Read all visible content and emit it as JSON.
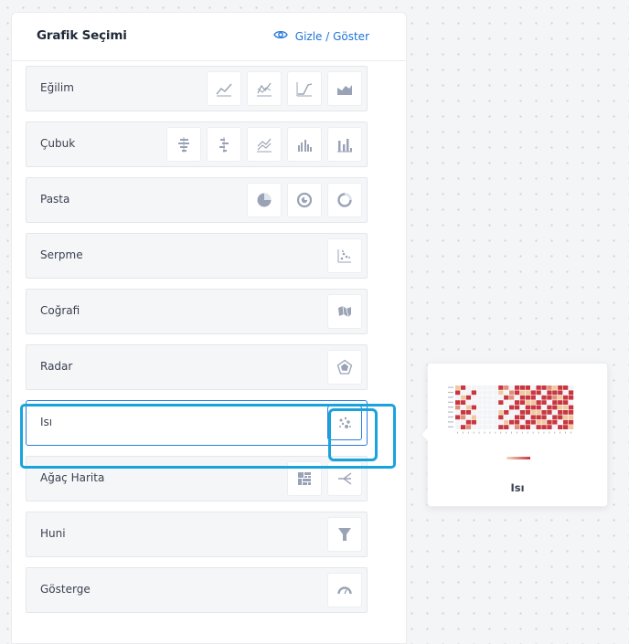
{
  "header": {
    "title": "Grafik Seçimi",
    "toggle_label": "Gizle / Göster",
    "toggle_icon": "eye-icon"
  },
  "rows": [
    {
      "label": "Eğilim",
      "icons": [
        "line-chart-icon",
        "multi-line-chart-icon",
        "step-line-chart-icon",
        "area-chart-icon"
      ]
    },
    {
      "label": "Çubuk",
      "icons": [
        "horizontal-bar-icon",
        "horizontal-stacked-bar-icon",
        "bar-line-combo-icon",
        "grouped-bar-icon",
        "column-bar-icon"
      ]
    },
    {
      "label": "Pasta",
      "icons": [
        "pie-chart-icon",
        "nested-pie-icon",
        "donut-chart-icon"
      ]
    },
    {
      "label": "Serpme",
      "icons": [
        "scatter-chart-icon"
      ]
    },
    {
      "label": "Coğrafi",
      "icons": [
        "map-chart-icon"
      ]
    },
    {
      "label": "Radar",
      "icons": [
        "radar-chart-icon"
      ]
    },
    {
      "label": "Isı",
      "icons": [
        "heatmap-icon"
      ],
      "selected": true
    },
    {
      "label": "Ağaç Harita",
      "icons": [
        "treemap-icon",
        "tree-chart-icon"
      ]
    },
    {
      "label": "Huni",
      "icons": [
        "funnel-chart-icon"
      ]
    },
    {
      "label": "Gösterge",
      "icons": [
        "gauge-chart-icon"
      ]
    }
  ],
  "preview": {
    "title": "Isı",
    "colors": {
      "low": "#f3f4f8",
      "mid": "#f0c9a0",
      "high": "#c8373f"
    }
  },
  "colors": {
    "accent": "#1e73d8",
    "highlight": "#19a3dd",
    "icon": "#9aa3b5"
  }
}
